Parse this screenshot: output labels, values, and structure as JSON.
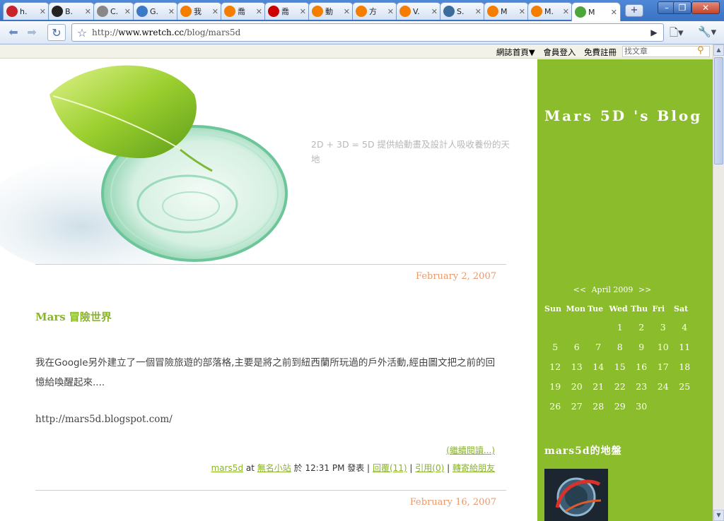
{
  "browser": {
    "tabs": [
      {
        "label": "h.",
        "icon": "zx-site-icon",
        "color": "#c8222a"
      },
      {
        "label": "B.",
        "icon": "yin-yang-icon",
        "color": "#222222"
      },
      {
        "label": "C.",
        "icon": "page-icon",
        "color": "#888888"
      },
      {
        "label": "G.",
        "icon": "rss-icon",
        "color": "#3a78c8"
      },
      {
        "label": "我",
        "icon": "blogger-icon",
        "color": "#f57d00"
      },
      {
        "label": "喬",
        "icon": "blogger-icon",
        "color": "#f57d00"
      },
      {
        "label": "喬",
        "icon": "yahoo-icon",
        "color": "#cc0000"
      },
      {
        "label": "動",
        "icon": "blogger-icon",
        "color": "#f57d00"
      },
      {
        "label": "方",
        "icon": "blogger-icon",
        "color": "#f57d00"
      },
      {
        "label": "V.",
        "icon": "blogger-icon",
        "color": "#f57d00"
      },
      {
        "label": "S.",
        "icon": "wordpress-icon",
        "color": "#3b6c9e"
      },
      {
        "label": "M",
        "icon": "blogger-icon",
        "color": "#f57d00"
      },
      {
        "label": "M.",
        "icon": "blogger-icon",
        "color": "#f57d00"
      },
      {
        "label": "M",
        "icon": "wretch-icon",
        "color": "#4ca63a"
      }
    ],
    "close_glyph": "✕",
    "new_tab_glyph": "+",
    "window_buttons": {
      "minimize": "–",
      "maximize": "❐",
      "close": "✕"
    },
    "url_prefix": "http://",
    "url_host": "www.wretch.cc",
    "url_path": "/blog/mars5d"
  },
  "sitebar": {
    "links": [
      "網誌首頁▼",
      "會員登入",
      "免費註冊"
    ],
    "search_placeholder": "找文章"
  },
  "header": {
    "tagline": "2D + 3D = 5D 提供給動畫及設計人吸收養份的天地"
  },
  "posts": [
    {
      "date": "February 2, 2007",
      "title": "Mars 冒險世界",
      "body": "我在Google另外建立了一個冒險旅遊的部落格,主要是將之前到紐西蘭所玩過的戶外活動,經由圖文把之前的回憶給喚醒起來....",
      "url_text": "http://mars5d.blogspot.com/",
      "read_more": "(繼續閱讀...)",
      "meta": {
        "author": "mars5d",
        "at": "at",
        "category": "無名小站",
        "posted": "於 12:31 PM 發表 |",
        "replies": "回覆(11)",
        "sep1": "|",
        "trackback": "引用(0)",
        "sep2": "|",
        "share": "轉寄給朋友"
      }
    },
    {
      "date": "February 16, 2007"
    }
  ],
  "sidebar": {
    "blog_title": "Mars 5D 's Blog",
    "calendar": {
      "prev": "<<",
      "month": "April 2009",
      "next": ">>",
      "weekdays": [
        "Sun",
        "Mon",
        "Tue",
        "Wed",
        "Thu",
        "Fri",
        "Sat"
      ],
      "weeks": [
        [
          "",
          "",
          "",
          "1",
          "2",
          "3",
          "4"
        ],
        [
          "5",
          "6",
          "7",
          "8",
          "9",
          "10",
          "11"
        ],
        [
          "12",
          "13",
          "14",
          "15",
          "16",
          "17",
          "18"
        ],
        [
          "19",
          "20",
          "21",
          "22",
          "23",
          "24",
          "25"
        ],
        [
          "26",
          "27",
          "28",
          "29",
          "30",
          "",
          ""
        ]
      ]
    },
    "map_title": "mars5d的地盤"
  },
  "colors": {
    "accent_green": "#8abc2b",
    "link_green": "#8ab52a",
    "date_orange": "#e89a6c"
  }
}
